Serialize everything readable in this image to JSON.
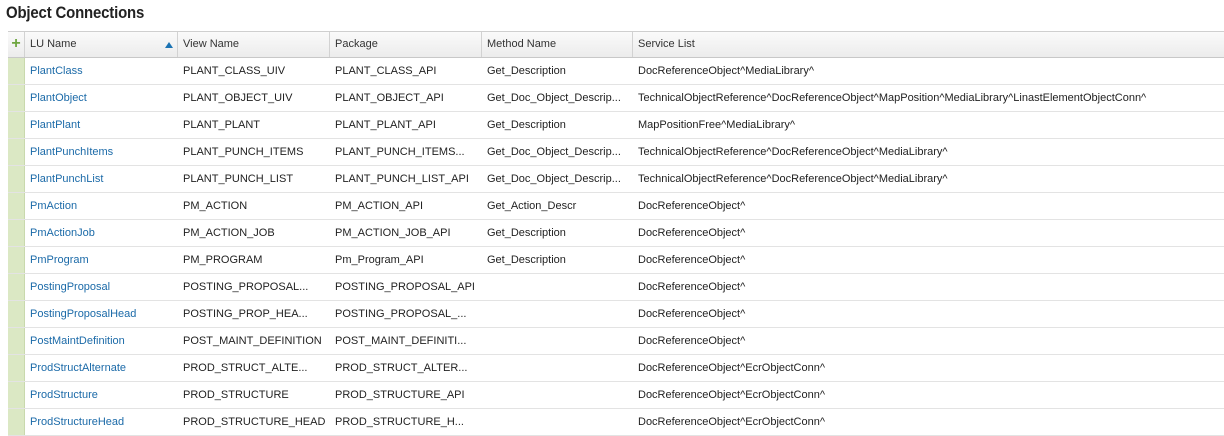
{
  "page": {
    "title": "Object Connections"
  },
  "table": {
    "add_icon": "+",
    "columns": [
      "LU Name",
      "View Name",
      "Package",
      "Method Name",
      "Service List"
    ],
    "rows": [
      [
        "PlantClass",
        "PLANT_CLASS_UIV",
        "PLANT_CLASS_API",
        "Get_Description",
        "DocReferenceObject^MediaLibrary^"
      ],
      [
        "PlantObject",
        "PLANT_OBJECT_UIV",
        "PLANT_OBJECT_API",
        "Get_Doc_Object_Descrip...",
        "TechnicalObjectReference^DocReferenceObject^MapPosition^MediaLibrary^LinastElementObjectConn^"
      ],
      [
        "PlantPlant",
        "PLANT_PLANT",
        "PLANT_PLANT_API",
        "Get_Description",
        "MapPositionFree^MediaLibrary^"
      ],
      [
        "PlantPunchItems",
        "PLANT_PUNCH_ITEMS",
        "PLANT_PUNCH_ITEMS...",
        "Get_Doc_Object_Descrip...",
        "TechnicalObjectReference^DocReferenceObject^MediaLibrary^"
      ],
      [
        "PlantPunchList",
        "PLANT_PUNCH_LIST",
        "PLANT_PUNCH_LIST_API",
        "Get_Doc_Object_Descrip...",
        "TechnicalObjectReference^DocReferenceObject^MediaLibrary^"
      ],
      [
        "PmAction",
        "PM_ACTION",
        "PM_ACTION_API",
        "Get_Action_Descr",
        "DocReferenceObject^"
      ],
      [
        "PmActionJob",
        "PM_ACTION_JOB",
        "PM_ACTION_JOB_API",
        "Get_Description",
        "DocReferenceObject^"
      ],
      [
        "PmProgram",
        "PM_PROGRAM",
        "Pm_Program_API",
        "Get_Description",
        "DocReferenceObject^"
      ],
      [
        "PostingProposal",
        "POSTING_PROPOSAL...",
        "POSTING_PROPOSAL_API",
        "",
        "DocReferenceObject^"
      ],
      [
        "PostingProposalHead",
        "POSTING_PROP_HEA...",
        "POSTING_PROPOSAL_...",
        "",
        "DocReferenceObject^"
      ],
      [
        "PostMaintDefinition",
        "POST_MAINT_DEFINITION",
        "POST_MAINT_DEFINITI...",
        "",
        "DocReferenceObject^"
      ],
      [
        "ProdStructAlternate",
        "PROD_STRUCT_ALTE...",
        "PROD_STRUCT_ALTER...",
        "",
        "DocReferenceObject^EcrObjectConn^"
      ],
      [
        "ProdStructure",
        "PROD_STRUCTURE",
        "PROD_STRUCTURE_API",
        "",
        "DocReferenceObject^EcrObjectConn^"
      ],
      [
        "ProdStructureHead",
        "PROD_STRUCTURE_HEAD",
        "PROD_STRUCTURE_H...",
        "",
        "DocReferenceObject^EcrObjectConn^"
      ]
    ]
  }
}
